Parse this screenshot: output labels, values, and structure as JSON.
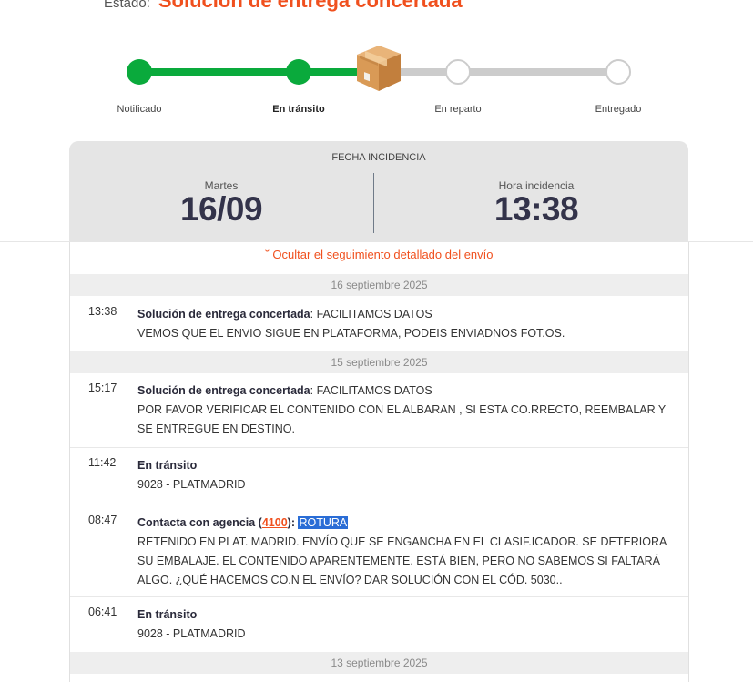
{
  "status": {
    "label": "Estado:",
    "value": "Solución de entrega concertada"
  },
  "tracker": {
    "steps": [
      {
        "label": "Notificado",
        "state": "done"
      },
      {
        "label": "En tránsito",
        "state": "current"
      },
      {
        "label": "En reparto",
        "state": "pending"
      },
      {
        "label": "Entregado",
        "state": "pending"
      }
    ],
    "current_icon": "package-box-icon",
    "colors": {
      "done": "#0aaa3c",
      "pending": "#cccccc"
    }
  },
  "incident": {
    "title": "FECHA INCIDENCIA",
    "day_label": "Martes",
    "date": "16/09",
    "time_label": "Hora incidencia",
    "time": "13:38"
  },
  "detail": {
    "toggle_label": "˘ Ocultar el seguimiento detallado del envío",
    "groups": [
      {
        "date": "16 septiembre 2025",
        "events": [
          {
            "time": "13:38",
            "title": "Solución de entrega concertada",
            "subtitle": ": FACILITAMOS DATOS",
            "lines": [
              "VEMOS QUE EL ENVIO SIGUE EN PLATAFORMA, PODEIS ENVIADNOS FOT.OS."
            ]
          }
        ]
      },
      {
        "date": "15 septiembre 2025",
        "events": [
          {
            "time": "15:17",
            "title": "Solución de entrega concertada",
            "subtitle": ": FACILITAMOS DATOS",
            "lines": [
              "POR FAVOR VERIFICAR EL CONTENIDO CON EL ALBARAN , SI ESTA CO.RRECTO, REEMBALAR Y",
              "SE ENTREGUE EN DESTINO."
            ]
          },
          {
            "time": "11:42",
            "title": "En tránsito",
            "lines": [
              "9028 - PLATMADRID"
            ]
          },
          {
            "time": "08:47",
            "title_prefix": "Contacta con agencia (",
            "agency": "4100",
            "title_suffix": "): ",
            "highlight": "ROTURA",
            "lines": [
              "RETENIDO EN PLAT. MADRID. ENVÍO QUE SE ENGANCHA EN EL CLASIF.ICADOR. SE DETERIORA",
              "SU EMBALAJE. EL CONTENIDO APARENTEMENTE. ESTÁ BIEN, PERO NO SABEMOS SI FALTARÁ",
              "ALGO. ¿QUÉ HACEMOS CO.N EL ENVÍO? DAR SOLUCIÓN CON EL CÓD. 5030.."
            ]
          },
          {
            "time": "06:41",
            "title": "En tránsito",
            "lines": [
              "9028 - PLATMADRID"
            ]
          }
        ]
      },
      {
        "date": "13 septiembre 2025",
        "events": []
      }
    ]
  },
  "accent_color": "#f0501e"
}
